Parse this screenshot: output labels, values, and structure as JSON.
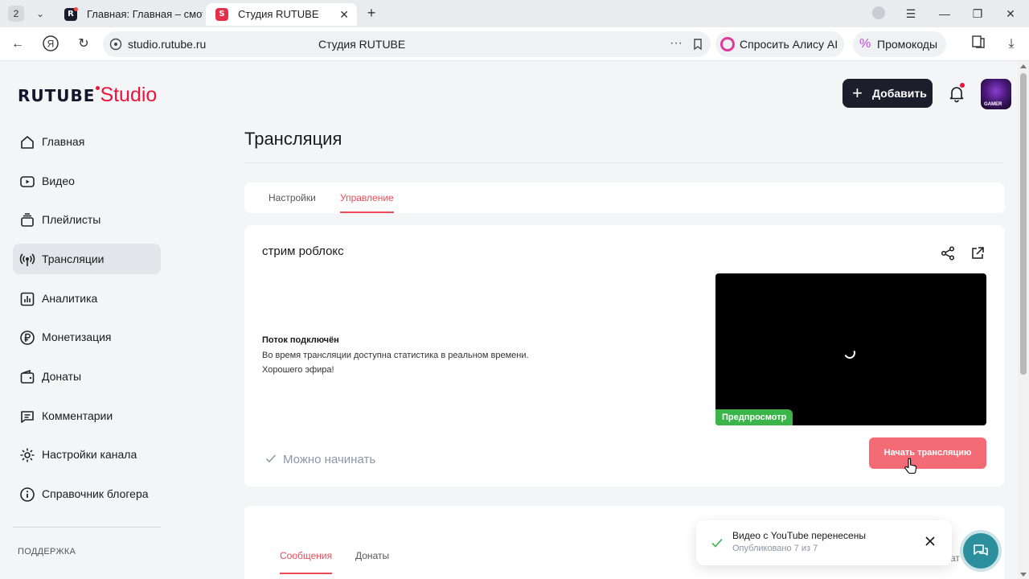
{
  "browser": {
    "tab_count": "2",
    "tabs": [
      {
        "title": "Главная: Главная – смотр"
      },
      {
        "title": "Студия RUTUBE"
      }
    ],
    "url": "studio.rutube.ru",
    "page_title": "Студия RUTUBE",
    "alice_label": "Спросить Алису AI",
    "promo_label": "Промокоды"
  },
  "header": {
    "logo_main": "RUTUBE",
    "logo_sub": "Studio",
    "add_label": "Добавить"
  },
  "sidebar": {
    "items": [
      {
        "label": "Главная"
      },
      {
        "label": "Видео"
      },
      {
        "label": "Плейлисты"
      },
      {
        "label": "Трансляции"
      },
      {
        "label": "Аналитика"
      },
      {
        "label": "Монетизация"
      },
      {
        "label": "Донаты"
      },
      {
        "label": "Комментарии"
      },
      {
        "label": "Настройки канала"
      },
      {
        "label": "Справочник блогера"
      }
    ],
    "active_index": 3,
    "support_label": "ПОДДЕРЖКА"
  },
  "main": {
    "title": "Трансляция",
    "tabs": [
      {
        "label": "Настройки"
      },
      {
        "label": "Управление"
      }
    ],
    "active_tab": "Управление",
    "stream": {
      "name": "стрим роблокс",
      "status_title": "Поток подключён",
      "status_lines": [
        "Во время трансляции доступна статистика в реальном времени.",
        "Хорошего эфира!"
      ],
      "preview_badge": "Предпросмотр",
      "ready_text": "Можно начинать",
      "start_button": "Начать трансляцию"
    },
    "chat": {
      "tabs": [
        {
          "label": "Сообщения"
        },
        {
          "label": "Донаты"
        }
      ],
      "active_tab": "Сообщения",
      "partial_text": "ат"
    }
  },
  "toast": {
    "title": "Видео с YouTube перенесены",
    "subtitle": "Опубликовано 7 из 7"
  },
  "colors": {
    "brand_red": "#ed143b",
    "accent_tab": "#ed4b57",
    "start_button": "#f26b75",
    "preview_badge": "#3bb44a",
    "help_fab": "#2b8f9d"
  }
}
